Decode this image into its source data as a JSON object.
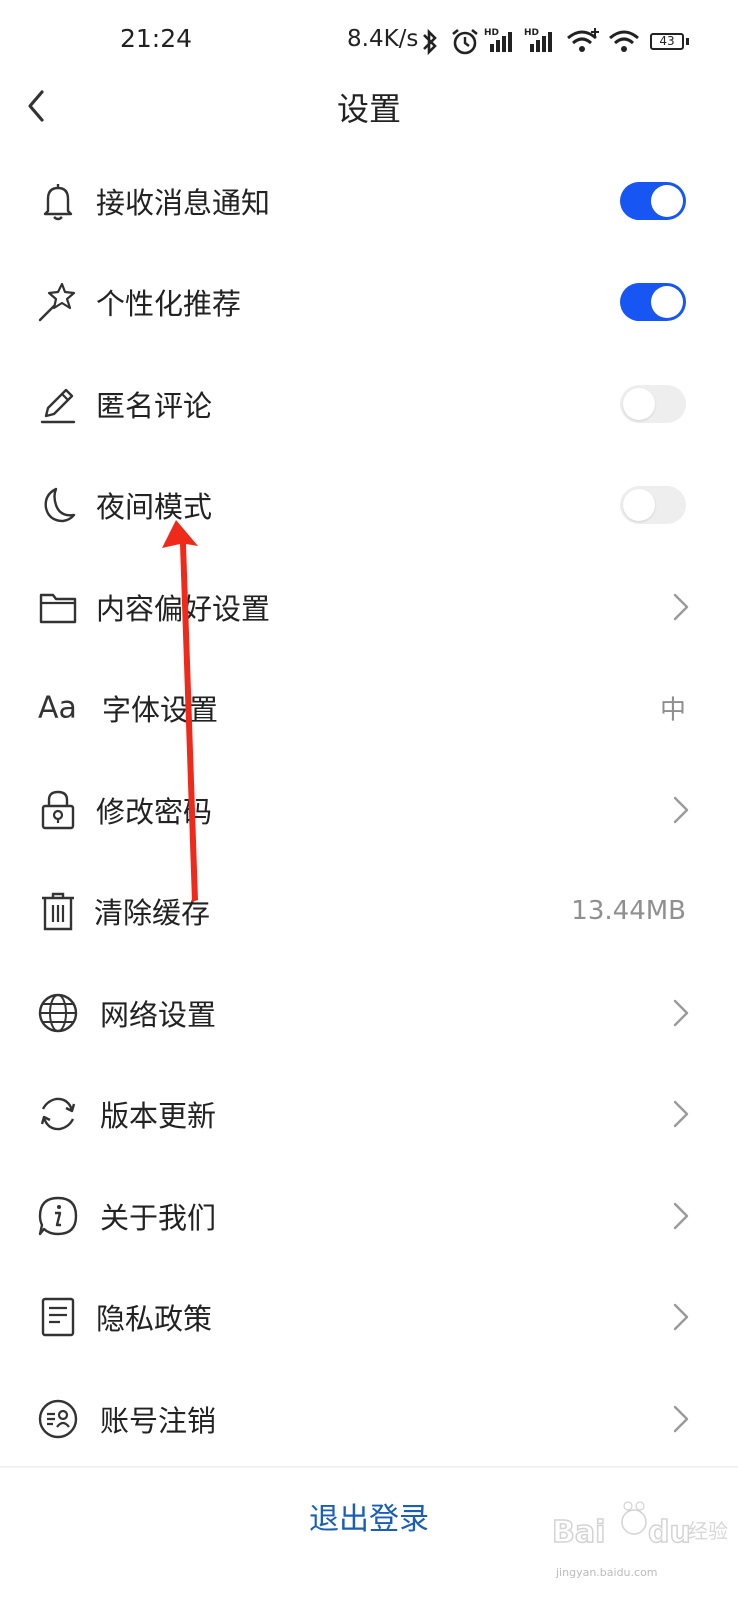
{
  "status_bar": {
    "time": "21:24",
    "network_speed": "8.4K/s",
    "battery_level": "43",
    "icons": [
      "bluetooth-icon",
      "alarm-icon",
      "signal-hd-icon",
      "signal-hd-icon",
      "wifi-plus-icon",
      "wifi-icon",
      "battery-icon"
    ]
  },
  "header": {
    "title": "设置",
    "back_icon": "chevron-left-icon"
  },
  "settings": [
    {
      "label": "接收消息通知",
      "icon": "bell-icon",
      "control": "toggle",
      "on": true
    },
    {
      "label": "个性化推荐",
      "icon": "magic-wand-icon",
      "control": "toggle",
      "on": true
    },
    {
      "label": "匿名评论",
      "icon": "pencil-icon",
      "control": "toggle",
      "on": false
    },
    {
      "label": "夜间模式",
      "icon": "moon-icon",
      "control": "toggle",
      "on": false
    },
    {
      "label": "内容偏好设置",
      "icon": "folder-icon",
      "control": "chevron"
    },
    {
      "label": "字体设置",
      "icon": "font-size-icon",
      "icon_text": "Aa",
      "control": "value",
      "value": "中"
    },
    {
      "label": "修改密码",
      "icon": "lock-icon",
      "control": "chevron"
    },
    {
      "label": "清除缓存",
      "icon": "trash-icon",
      "control": "value",
      "value": "13.44MB"
    },
    {
      "label": "网络设置",
      "icon": "globe-icon",
      "control": "chevron"
    },
    {
      "label": "版本更新",
      "icon": "refresh-icon",
      "control": "chevron"
    },
    {
      "label": "关于我们",
      "icon": "info-icon",
      "control": "chevron"
    },
    {
      "label": "隐私政策",
      "icon": "document-icon",
      "control": "chevron"
    },
    {
      "label": "账号注销",
      "icon": "account-cancel-icon",
      "control": "chevron"
    }
  ],
  "footer": {
    "logout_label": "退出登录"
  },
  "watermark": {
    "text": "Baidu经验",
    "domain": "jingyan.baidu.com"
  },
  "colors": {
    "accent": "#1756f2",
    "logout_text": "#1a5fb4",
    "toggle_off": "#eeeeee",
    "secondary_text": "#8f8f8f",
    "annotation_arrow": "#f02a1b"
  }
}
